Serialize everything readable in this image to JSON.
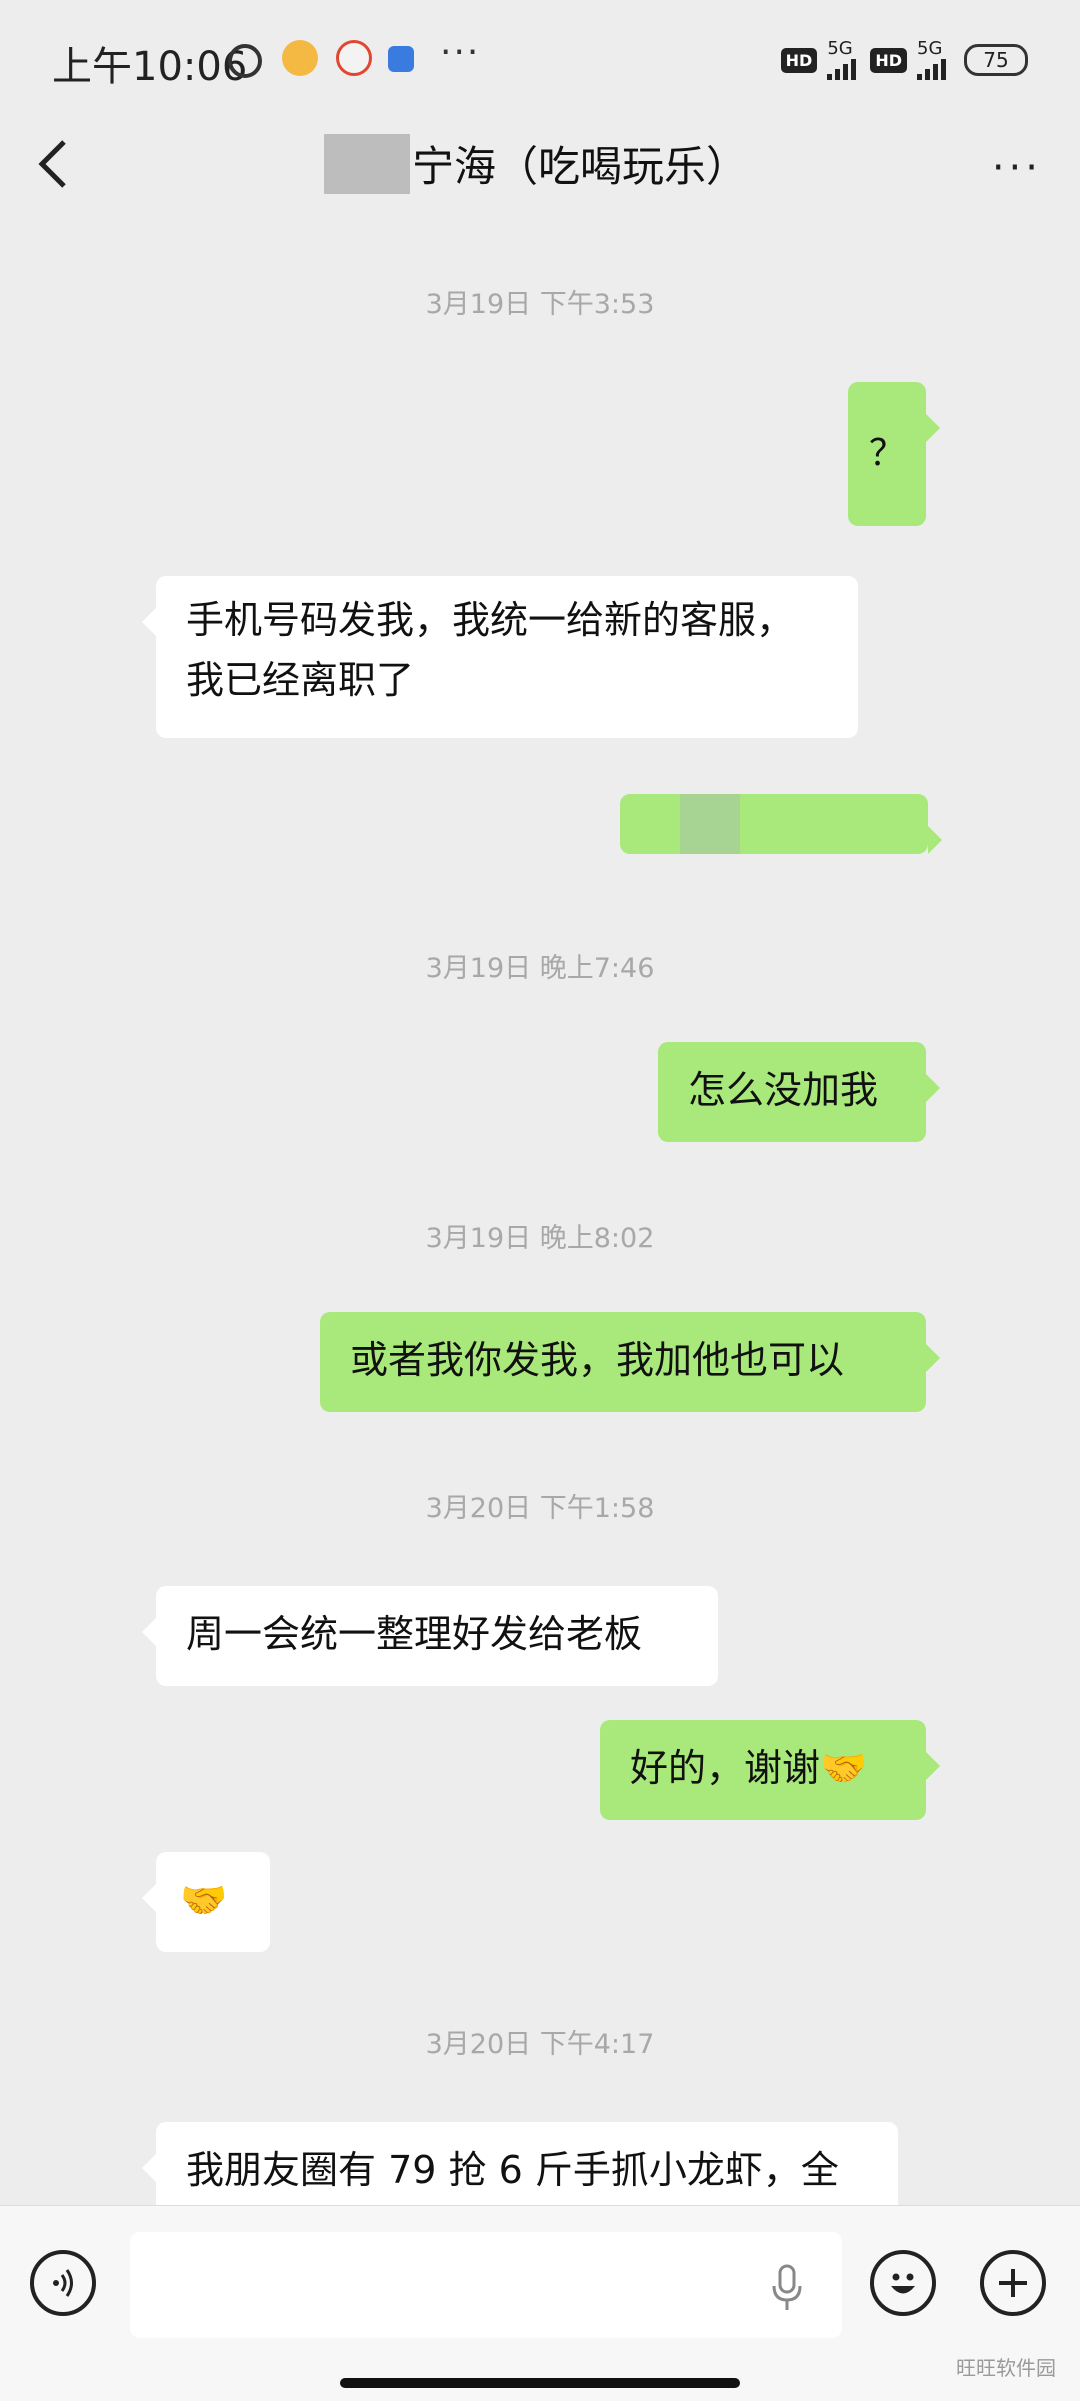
{
  "status_bar": {
    "time": "上午10:06",
    "network_label_1": "5G",
    "network_label_2": "5G",
    "hd_1": "HD",
    "hd_2": "HD",
    "battery": "75",
    "more_dots": "···"
  },
  "header": {
    "title": "宁海（吃喝玩乐）",
    "more": "···"
  },
  "messages": {
    "ts1": "3月19日 下午3:53",
    "m1": "？",
    "m2_line1": "手机号码发我，我统一给新的客服，",
    "m2_line2": "我已经离职了",
    "ts2": "3月19日 晚上7:46",
    "m4": "怎么没加我",
    "ts3": "3月19日 晚上8:02",
    "m5": "或者我你发我，我加他也可以",
    "ts4": "3月20日 下午1:58",
    "m6": "周一会统一整理好发给老板",
    "m7": "好的，谢谢🤝",
    "m8": "🤝",
    "ts5": "3月20日 下午4:17",
    "m9": "我朋友圈有 79 抢 6 斤手抓小龙虾，全"
  },
  "colors": {
    "background": "#ededed",
    "outgoing_bubble": "#a9e87a",
    "incoming_bubble": "#ffffff",
    "timestamp": "#a8a8a8"
  },
  "icons": {
    "back": "chevron-left-icon",
    "more": "more-dots-icon",
    "voice": "voice-icon",
    "mic": "microphone-icon",
    "emoji": "emoji-icon",
    "plus": "plus-icon"
  },
  "watermark": "旺旺软件园"
}
